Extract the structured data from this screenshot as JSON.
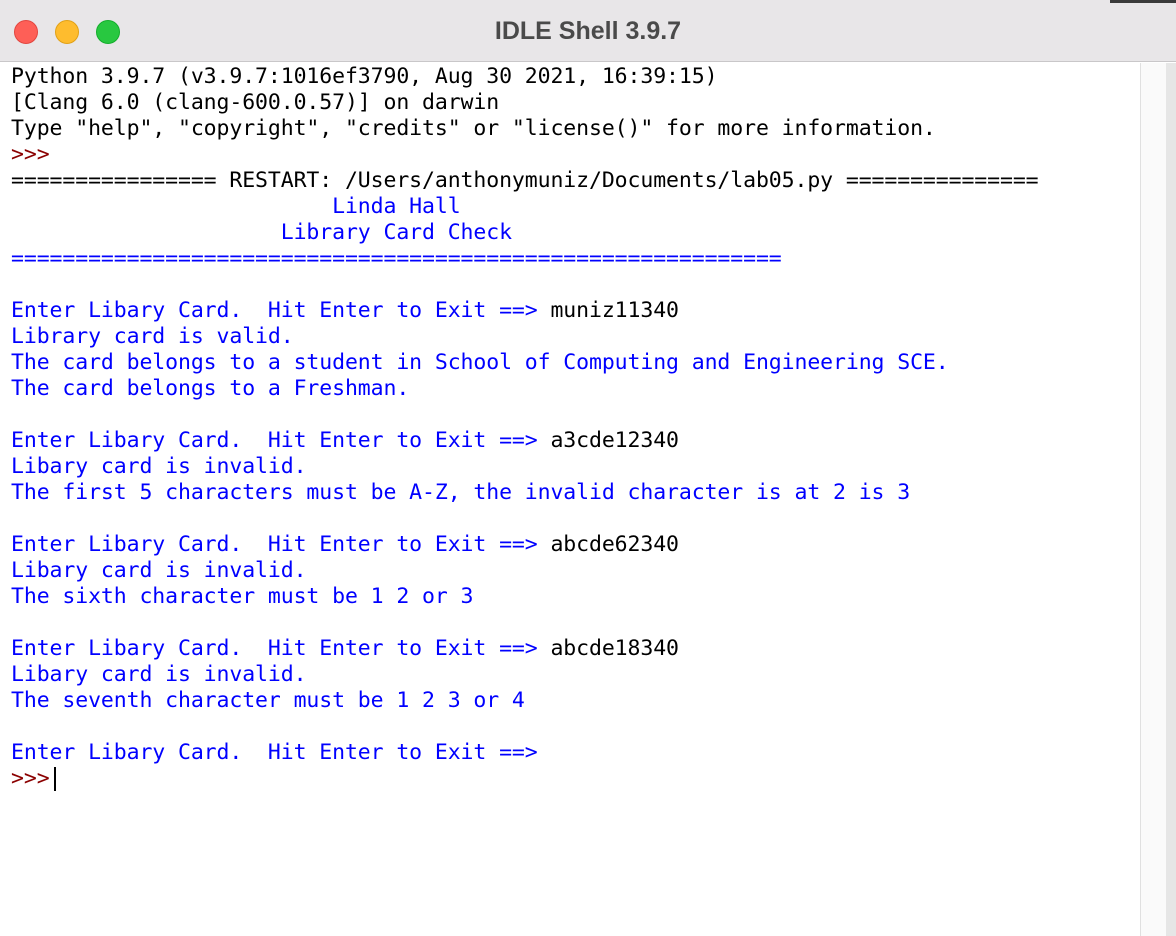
{
  "window": {
    "title": "IDLE Shell 3.9.7"
  },
  "banner": {
    "line1": "Python 3.9.7 (v3.9.7:1016ef3790, Aug 30 2021, 16:39:15)",
    "line2": "[Clang 6.0 (clang-600.0.57)] on darwin",
    "line3": "Type \"help\", \"copyright\", \"credits\" or \"license()\" for more information."
  },
  "prompt": ">>>",
  "restart_line": "================ RESTART: /Users/anthonymuniz/Documents/lab05.py ===============",
  "program": {
    "header1": "                         Linda Hall",
    "header2": "                     Library Card Check",
    "rule": "============================================================",
    "entries": [
      {
        "prompt": "Enter Libary Card.  Hit Enter to Exit ==> ",
        "input": "muniz11340",
        "output": [
          "Library card is valid.",
          "The card belongs to a student in School of Computing and Engineering SCE.",
          "The card belongs to a Freshman."
        ]
      },
      {
        "prompt": "Enter Libary Card.  Hit Enter to Exit ==> ",
        "input": "a3cde12340",
        "output": [
          "Libary card is invalid.",
          "The first 5 characters must be A-Z, the invalid character is at 2 is 3"
        ]
      },
      {
        "prompt": "Enter Libary Card.  Hit Enter to Exit ==> ",
        "input": "abcde62340",
        "output": [
          "Libary card is invalid.",
          "The sixth character must be 1 2 or 3"
        ]
      },
      {
        "prompt": "Enter Libary Card.  Hit Enter to Exit ==> ",
        "input": "abcde18340",
        "output": [
          "Libary card is invalid.",
          "The seventh character must be 1 2 3 or 4"
        ]
      }
    ],
    "final_prompt": "Enter Libary Card.  Hit Enter to Exit ==>"
  },
  "colors": {
    "stdout": "#0000ff",
    "prompt": "#8b0000",
    "input": "#000000"
  }
}
